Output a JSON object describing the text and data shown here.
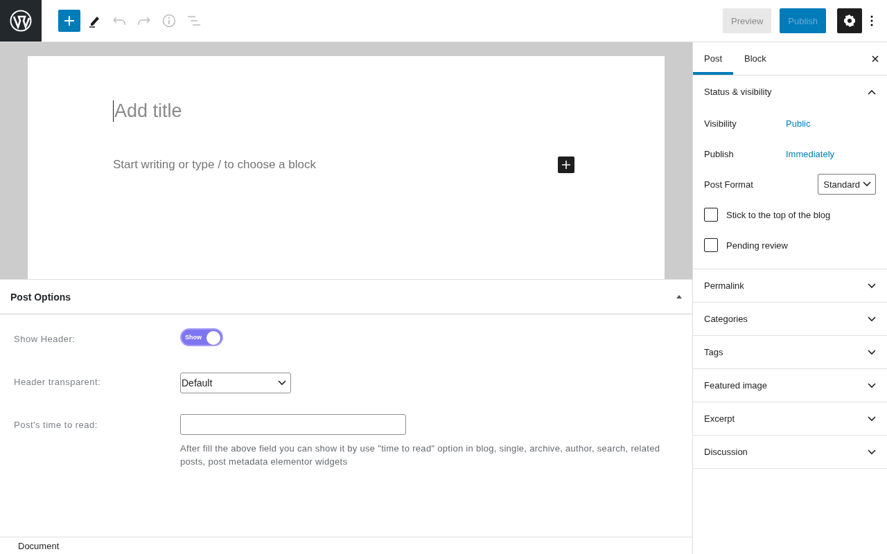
{
  "toolbar": {
    "preview": "Preview",
    "publish": "Publish",
    "settings_active": true
  },
  "editor": {
    "title_placeholder": "Add title",
    "body_placeholder": "Start writing or type / to choose a block"
  },
  "post_options": {
    "title": "Post Options",
    "expanded": true,
    "fields": [
      {
        "kind": "toggle",
        "label": "Show Header:",
        "toggle_label": "Show",
        "on": true
      },
      {
        "kind": "select",
        "label": "Header transparent:",
        "value": "Default"
      },
      {
        "kind": "text",
        "label": "Post's time to read:",
        "help": "After fill the above field you can show it by use \"time to read\" option in blog, single, archive, author, search, related posts, post metadata elementor widgets"
      }
    ]
  },
  "sidebar": {
    "tabs": [
      {
        "label": "Post",
        "selected": true
      },
      {
        "label": "Block",
        "selected": false
      }
    ],
    "sections": [
      {
        "title": "Status & visibility",
        "expanded": true,
        "rows": [
          {
            "kind": "link",
            "label": "Visibility",
            "value": "Public"
          },
          {
            "kind": "link",
            "label": "Publish",
            "value": "Immediately"
          },
          {
            "kind": "select",
            "label": "Post Format",
            "value": "Standard"
          },
          {
            "kind": "checkbox",
            "label": "Stick to the top of the blog",
            "checked": false
          },
          {
            "kind": "checkbox",
            "label": "Pending review",
            "checked": false
          }
        ]
      },
      {
        "title": "Permalink",
        "expanded": false
      },
      {
        "title": "Categories",
        "expanded": false
      },
      {
        "title": "Tags",
        "expanded": false
      },
      {
        "title": "Featured image",
        "expanded": false
      },
      {
        "title": "Excerpt",
        "expanded": false
      },
      {
        "title": "Discussion",
        "expanded": false
      }
    ]
  },
  "footer": {
    "breadcrumb": "Document"
  }
}
